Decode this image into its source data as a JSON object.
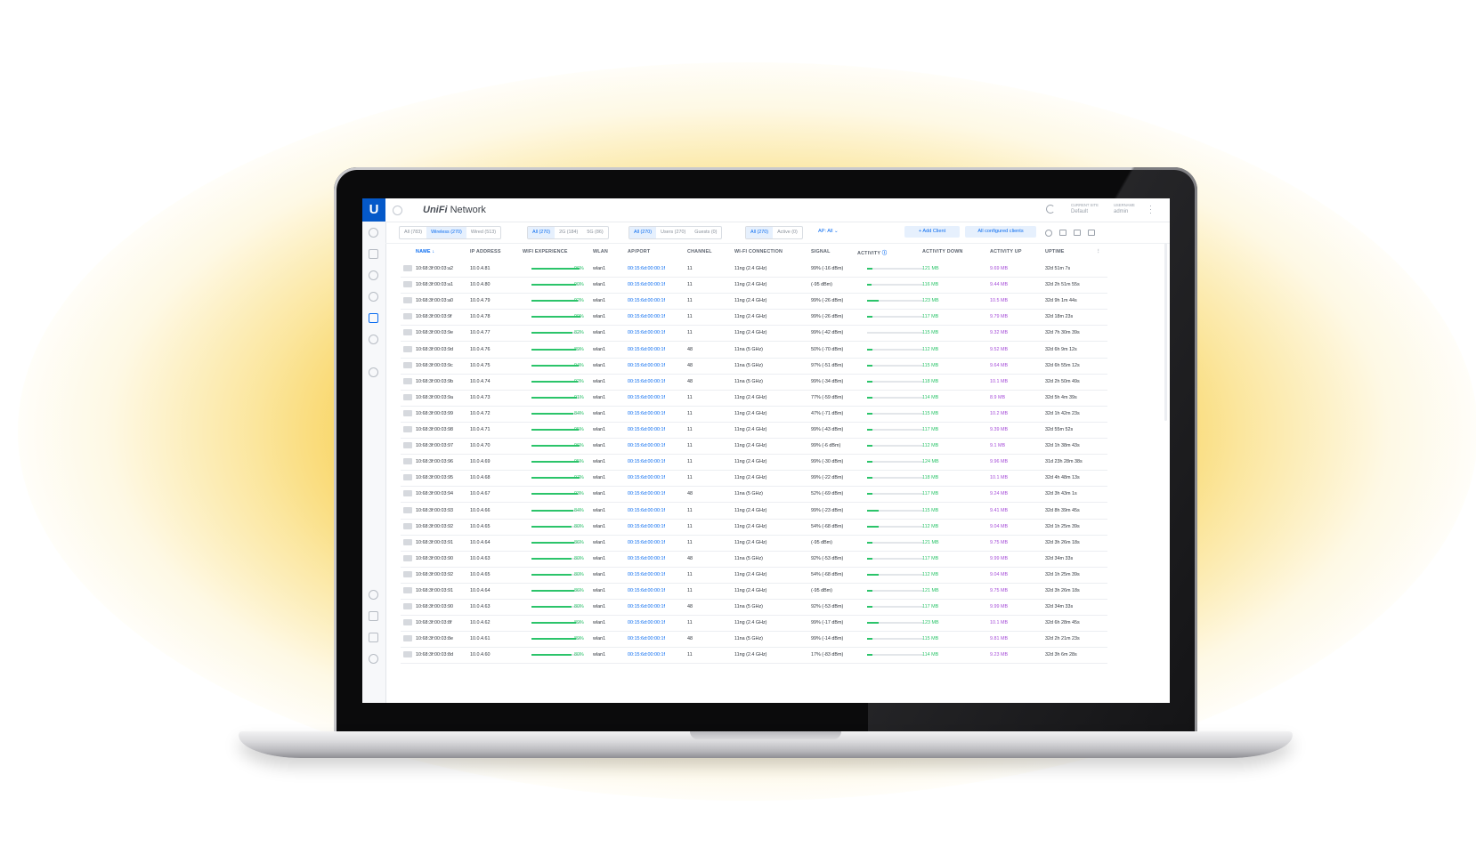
{
  "app": {
    "brand_logo": "UniFi",
    "brand_name": "Network",
    "site_label": "CURRENT SITE",
    "site_value": "Default",
    "user_label": "USERNAME",
    "user_value": "admin"
  },
  "filters": {
    "conn": [
      "All (783)",
      "Wireless (270)",
      "Wired (513)"
    ],
    "band": [
      "All (270)",
      "2G (184)",
      "5G (86)"
    ],
    "type": [
      "All (270)",
      "Users (270)",
      "Guests (0)"
    ],
    "state": [
      "All (270)",
      "Active (0)"
    ],
    "ap": "AP: All",
    "add_client": "Add Client",
    "all_configured": "All configured clients"
  },
  "columns": [
    "NAME",
    "IP ADDRESS",
    "WIFI EXPERIENCE",
    "WLAN",
    "AP/PORT",
    "CHANNEL",
    "WI-FI CONNECTION",
    "SIGNAL",
    "ACTIVITY",
    "ACTIVITY DOWN",
    "ACTIVITY UP",
    "UPTIME"
  ],
  "rows": [
    {
      "name": "10:68:3f:00:03:a2",
      "ip": "10.0.4.81",
      "exp": 96,
      "wlan": "wlan1",
      "ap": "00:15:6d:00:00:1f",
      "ch": "11",
      "conn": "11ng (2.4 GHz)",
      "signal": "99% (-16 dBm)",
      "act": 10,
      "down": "121 MB",
      "up": "9.69 MB",
      "uptime": "32d 51m 7s"
    },
    {
      "name": "10:68:3f:00:03:a1",
      "ip": "10.0.4.80",
      "exp": 90,
      "wlan": "wlan1",
      "ap": "00:15:6d:00:00:1f",
      "ch": "11",
      "conn": "11ng (2.4 GHz)",
      "signal": "(-95 dBm)",
      "act": 8,
      "down": "116 MB",
      "up": "9.44 MB",
      "uptime": "32d 2h 51m 55s"
    },
    {
      "name": "10:68:3f:00:03:a0",
      "ip": "10.0.4.79",
      "exp": 92,
      "wlan": "wlan1",
      "ap": "00:15:6d:00:00:1f",
      "ch": "11",
      "conn": "11ng (2.4 GHz)",
      "signal": "99% (-26 dBm)",
      "act": 20,
      "down": "123 MB",
      "up": "10.5 MB",
      "uptime": "32d 9h 1m 44s"
    },
    {
      "name": "10:68:3f:00:03:9f",
      "ip": "10.0.4.78",
      "exp": 99,
      "wlan": "wlan1",
      "ap": "00:15:6d:00:00:1f",
      "ch": "11",
      "conn": "11ng (2.4 GHz)",
      "signal": "99% (-26 dBm)",
      "act": 10,
      "down": "117 MB",
      "up": "9.79 MB",
      "uptime": "32d 18m 23s"
    },
    {
      "name": "10:68:3f:00:03:9e",
      "ip": "10.0.4.77",
      "exp": 82,
      "wlan": "wlan1",
      "ap": "00:15:6d:00:00:1f",
      "ch": "11",
      "conn": "11ng (2.4 GHz)",
      "signal": "99% (-42 dBm)",
      "act": 0,
      "down": "115 MB",
      "up": "9.32 MB",
      "uptime": "32d 7h 30m 39s"
    },
    {
      "name": "10:68:3f:00:03:9d",
      "ip": "10.0.4.76",
      "exp": 89,
      "wlan": "wlan1",
      "ap": "00:15:6d:00:00:1f",
      "ch": "48",
      "conn": "11na (5 GHz)",
      "signal": "50% (-70 dBm)",
      "act": 10,
      "down": "112 MB",
      "up": "9.52 MB",
      "uptime": "32d 6h 9m 12s"
    },
    {
      "name": "10:68:3f:00:03:9c",
      "ip": "10.0.4.75",
      "exp": 94,
      "wlan": "wlan1",
      "ap": "00:15:6d:00:00:1f",
      "ch": "48",
      "conn": "11na (5 GHz)",
      "signal": "97% (-51 dBm)",
      "act": 10,
      "down": "115 MB",
      "up": "9.64 MB",
      "uptime": "32d 6h 55m 12s"
    },
    {
      "name": "10:68:3f:00:03:9b",
      "ip": "10.0.4.74",
      "exp": 92,
      "wlan": "wlan1",
      "ap": "00:15:6d:00:00:1f",
      "ch": "48",
      "conn": "11na (5 GHz)",
      "signal": "99% (-34 dBm)",
      "act": 10,
      "down": "118 MB",
      "up": "10.1 MB",
      "uptime": "32d 2h 50m 49s"
    },
    {
      "name": "10:68:3f:00:03:9a",
      "ip": "10.0.4.73",
      "exp": 91,
      "wlan": "wlan1",
      "ap": "00:15:6d:00:00:1f",
      "ch": "11",
      "conn": "11ng (2.4 GHz)",
      "signal": "77% (-59 dBm)",
      "act": 10,
      "down": "114 MB",
      "up": "8.9 MB",
      "uptime": "32d 5h 4m 39s"
    },
    {
      "name": "10:68:3f:00:03:99",
      "ip": "10.0.4.72",
      "exp": 84,
      "wlan": "wlan1",
      "ap": "00:15:6d:00:00:1f",
      "ch": "11",
      "conn": "11ng (2.4 GHz)",
      "signal": "47% (-71 dBm)",
      "act": 10,
      "down": "115 MB",
      "up": "10.2 MB",
      "uptime": "32d 1h 42m 23s"
    },
    {
      "name": "10:68:3f:00:03:98",
      "ip": "10.0.4.71",
      "exp": 95,
      "wlan": "wlan1",
      "ap": "00:15:6d:00:00:1f",
      "ch": "11",
      "conn": "11ng (2.4 GHz)",
      "signal": "99% (-43 dBm)",
      "act": 10,
      "down": "117 MB",
      "up": "9.39 MB",
      "uptime": "32d 55m 52s"
    },
    {
      "name": "10:68:3f:00:03:97",
      "ip": "10.0.4.70",
      "exp": 96,
      "wlan": "wlan1",
      "ap": "00:15:6d:00:00:1f",
      "ch": "11",
      "conn": "11ng (2.4 GHz)",
      "signal": "99% (-6 dBm)",
      "act": 10,
      "down": "112 MB",
      "up": "9.1 MB",
      "uptime": "32d 1h 38m 43s"
    },
    {
      "name": "10:68:3f:00:03:96",
      "ip": "10.0.4.69",
      "exp": 95,
      "wlan": "wlan1",
      "ap": "00:15:6d:00:00:1f",
      "ch": "11",
      "conn": "11ng (2.4 GHz)",
      "signal": "99% (-30 dBm)",
      "act": 10,
      "down": "124 MB",
      "up": "9.96 MB",
      "uptime": "31d 23h 28m 38s"
    },
    {
      "name": "10:68:3f:00:03:95",
      "ip": "10.0.4.68",
      "exp": 97,
      "wlan": "wlan1",
      "ap": "00:15:6d:00:00:1f",
      "ch": "11",
      "conn": "11ng (2.4 GHz)",
      "signal": "99% (-22 dBm)",
      "act": 10,
      "down": "118 MB",
      "up": "10.1 MB",
      "uptime": "32d 4h 48m 13s"
    },
    {
      "name": "10:68:3f:00:03:94",
      "ip": "10.0.4.67",
      "exp": 93,
      "wlan": "wlan1",
      "ap": "00:15:6d:00:00:1f",
      "ch": "48",
      "conn": "11na (5 GHz)",
      "signal": "52% (-69 dBm)",
      "act": 10,
      "down": "117 MB",
      "up": "9.24 MB",
      "uptime": "32d 3h 43m 1s"
    },
    {
      "name": "10:68:3f:00:03:93",
      "ip": "10.0.4.66",
      "exp": 84,
      "wlan": "wlan1",
      "ap": "00:15:6d:00:00:1f",
      "ch": "11",
      "conn": "11ng (2.4 GHz)",
      "signal": "99% (-23 dBm)",
      "act": 20,
      "down": "115 MB",
      "up": "9.41 MB",
      "uptime": "32d 8h 39m 45s"
    },
    {
      "name": "10:68:3f:00:03:92",
      "ip": "10.0.4.65",
      "exp": 80,
      "wlan": "wlan1",
      "ap": "00:15:6d:00:00:1f",
      "ch": "11",
      "conn": "11ng (2.4 GHz)",
      "signal": "54% (-68 dBm)",
      "act": 20,
      "down": "112 MB",
      "up": "9.04 MB",
      "uptime": "32d 1h 25m 39s"
    },
    {
      "name": "10:68:3f:00:03:91",
      "ip": "10.0.4.64",
      "exp": 86,
      "wlan": "wlan1",
      "ap": "00:15:6d:00:00:1f",
      "ch": "11",
      "conn": "11ng (2.4 GHz)",
      "signal": "(-95 dBm)",
      "act": 10,
      "down": "121 MB",
      "up": "9.75 MB",
      "uptime": "32d 3h 26m 18s"
    },
    {
      "name": "10:68:3f:00:03:90",
      "ip": "10.0.4.63",
      "exp": 80,
      "wlan": "wlan1",
      "ap": "00:15:6d:00:00:1f",
      "ch": "48",
      "conn": "11na (5 GHz)",
      "signal": "92% (-53 dBm)",
      "act": 10,
      "down": "117 MB",
      "up": "9.99 MB",
      "uptime": "32d 34m 33s"
    },
    {
      "name": "10:68:3f:00:03:92",
      "ip": "10.0.4.65",
      "exp": 80,
      "wlan": "wlan1",
      "ap": "00:15:6d:00:00:1f",
      "ch": "11",
      "conn": "11ng (2.4 GHz)",
      "signal": "54% (-68 dBm)",
      "act": 20,
      "down": "112 MB",
      "up": "9.04 MB",
      "uptime": "32d 1h 25m 39s"
    },
    {
      "name": "10:68:3f:00:03:91",
      "ip": "10.0.4.64",
      "exp": 86,
      "wlan": "wlan1",
      "ap": "00:15:6d:00:00:1f",
      "ch": "11",
      "conn": "11ng (2.4 GHz)",
      "signal": "(-95 dBm)",
      "act": 10,
      "down": "121 MB",
      "up": "9.75 MB",
      "uptime": "32d 3h 26m 18s"
    },
    {
      "name": "10:68:3f:00:03:90",
      "ip": "10.0.4.63",
      "exp": 80,
      "wlan": "wlan1",
      "ap": "00:15:6d:00:00:1f",
      "ch": "48",
      "conn": "11na (5 GHz)",
      "signal": "92% (-53 dBm)",
      "act": 10,
      "down": "117 MB",
      "up": "9.99 MB",
      "uptime": "32d 34m 33s"
    },
    {
      "name": "10:68:3f:00:03:8f",
      "ip": "10.0.4.62",
      "exp": 89,
      "wlan": "wlan1",
      "ap": "00:15:6d:00:00:1f",
      "ch": "11",
      "conn": "11ng (2.4 GHz)",
      "signal": "99% (-17 dBm)",
      "act": 20,
      "down": "123 MB",
      "up": "10.1 MB",
      "uptime": "32d 6h 28m 45s"
    },
    {
      "name": "10:68:3f:00:03:8e",
      "ip": "10.0.4.61",
      "exp": 89,
      "wlan": "wlan1",
      "ap": "00:15:6d:00:00:1f",
      "ch": "48",
      "conn": "11na (5 GHz)",
      "signal": "99% (-14 dBm)",
      "act": 10,
      "down": "115 MB",
      "up": "9.81 MB",
      "uptime": "32d 2h 21m 23s"
    },
    {
      "name": "10:68:3f:00:03:8d",
      "ip": "10.0.4.60",
      "exp": 80,
      "wlan": "wlan1",
      "ap": "00:15:6d:00:00:1f",
      "ch": "11",
      "conn": "11ng (2.4 GHz)",
      "signal": "17% (-83 dBm)",
      "act": 10,
      "down": "114 MB",
      "up": "9.23 MB",
      "uptime": "32d 3h 6m 28s"
    }
  ]
}
